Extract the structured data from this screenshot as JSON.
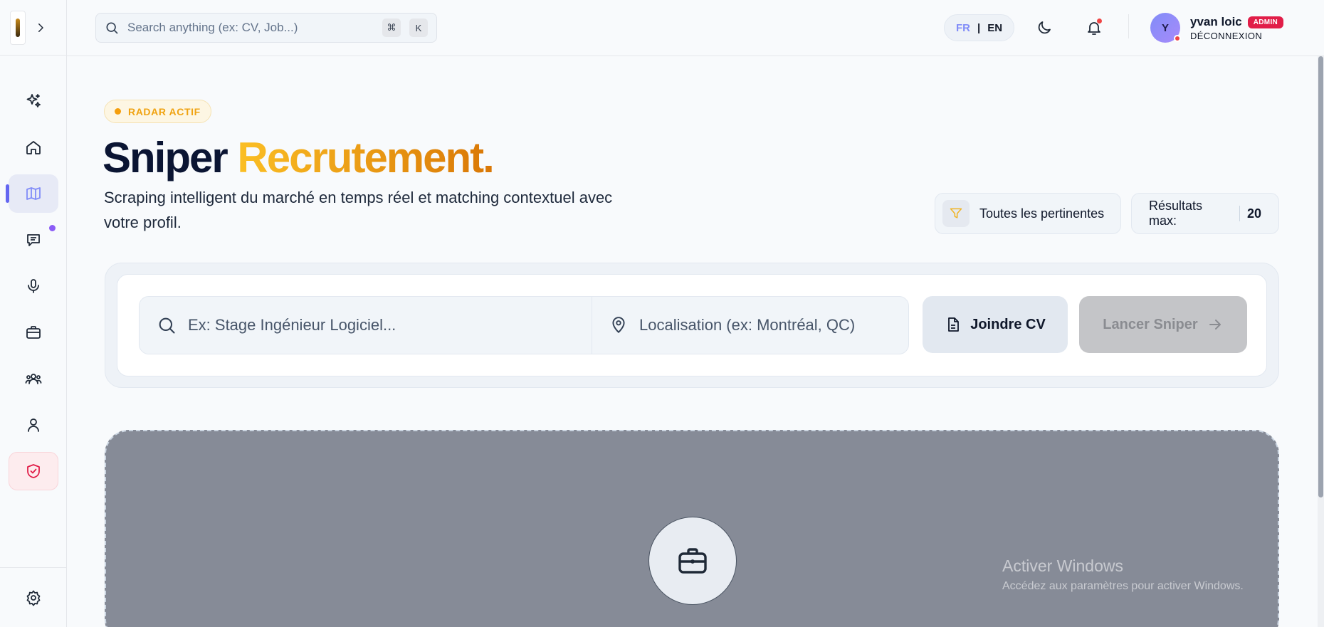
{
  "header": {
    "search_placeholder": "Search anything (ex: CV, Job...)",
    "shortcut_cmd": "⌘",
    "shortcut_key": "K",
    "lang_fr": "FR",
    "lang_sep": "|",
    "lang_en": "EN",
    "avatar_initial": "Y",
    "user_name": "yvan loic",
    "user_badge": "ADMIN",
    "logout_label": "DÉCONNEXION"
  },
  "sidebar": {
    "items": [
      {
        "name": "sparkles-icon"
      },
      {
        "name": "home-icon"
      },
      {
        "name": "map-icon",
        "active": true
      },
      {
        "name": "chat-icon",
        "notification": true
      },
      {
        "name": "microphone-icon"
      },
      {
        "name": "briefcase-icon"
      },
      {
        "name": "users-icon"
      },
      {
        "name": "user-icon"
      },
      {
        "name": "shield-check-icon"
      }
    ],
    "bottom": "settings-icon"
  },
  "hero": {
    "badge": "RADAR ACTIF",
    "title_main": "Sniper",
    "title_accent": "Recrutement.",
    "subtitle": "Scraping intelligent du marché en temps réel et matching contextuel avec votre profil."
  },
  "controls": {
    "filter_label": "Toutes les pertinentes",
    "max_label": "Résultats max:",
    "max_value": "20"
  },
  "search_panel": {
    "job_placeholder": "Ex: Stage Ingénieur Logiciel...",
    "location_placeholder": "Localisation (ex: Montréal, QC)",
    "cv_button": "Joindre CV",
    "launch_button": "Lancer Sniper"
  },
  "watermark": {
    "title": "Activer Windows",
    "subtitle": "Accédez aux paramètres pour activer Windows."
  },
  "colors": {
    "accent_indigo": "#6366f1",
    "accent_amber": "#f59e0b",
    "danger": "#e11d48"
  }
}
